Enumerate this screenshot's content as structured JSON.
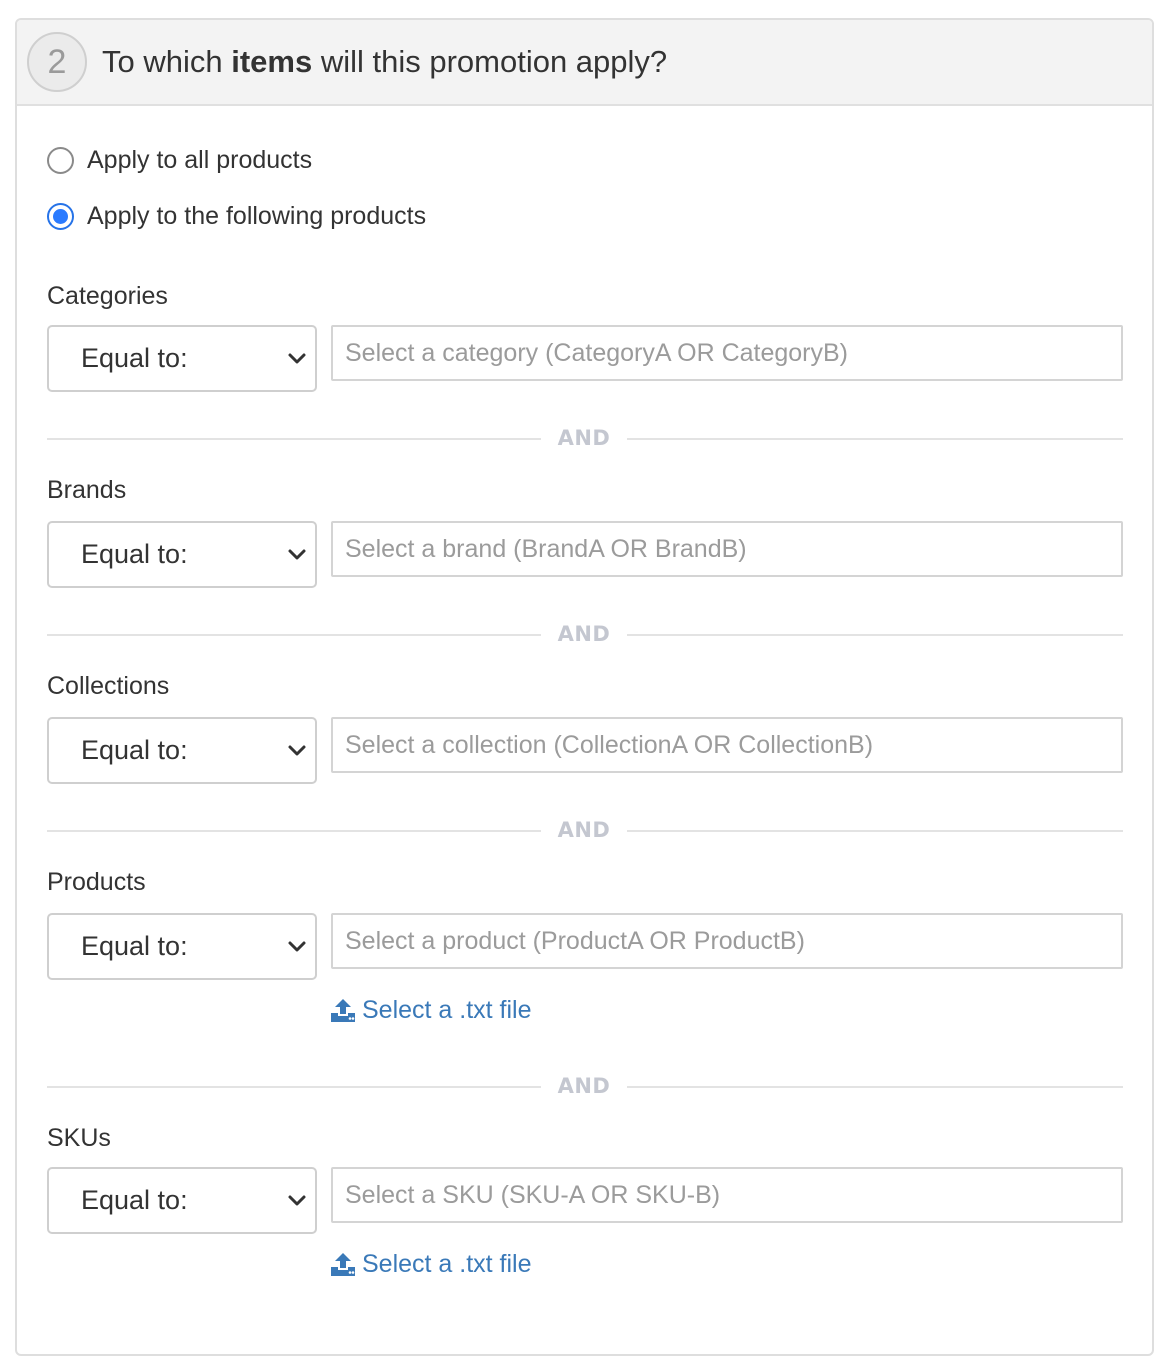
{
  "header": {
    "step_number": "2",
    "title_prefix": "To which ",
    "title_bold": "items",
    "title_suffix": " will this promotion apply?"
  },
  "apply_options": [
    {
      "label": "Apply to all products",
      "checked": false
    },
    {
      "label": "Apply to the following products",
      "checked": true
    }
  ],
  "divider_label": "AND",
  "fields": {
    "categories": {
      "label": "Categories",
      "operator": "Equal to:",
      "placeholder": "Select a category (CategoryA OR CategoryB)"
    },
    "brands": {
      "label": "Brands",
      "operator": "Equal to:",
      "placeholder": "Select a brand (BrandA OR BrandB)"
    },
    "collections": {
      "label": "Collections",
      "operator": "Equal to:",
      "placeholder": "Select a collection (CollectionA OR CollectionB)"
    },
    "products": {
      "label": "Products",
      "operator": "Equal to:",
      "placeholder": "Select a product (ProductA OR ProductB)",
      "file_link": "Select a .txt file"
    },
    "skus": {
      "label": "SKUs",
      "operator": "Equal to:",
      "placeholder": "Select a SKU (SKU-A OR SKU-B)",
      "file_link": "Select a .txt file"
    }
  },
  "colors": {
    "accent": "#2b7bff",
    "link": "#3a79b8",
    "divider_text": "#c4c7d0"
  },
  "icons": {
    "upload": "upload-icon",
    "chevron": "chevron-down-icon"
  }
}
